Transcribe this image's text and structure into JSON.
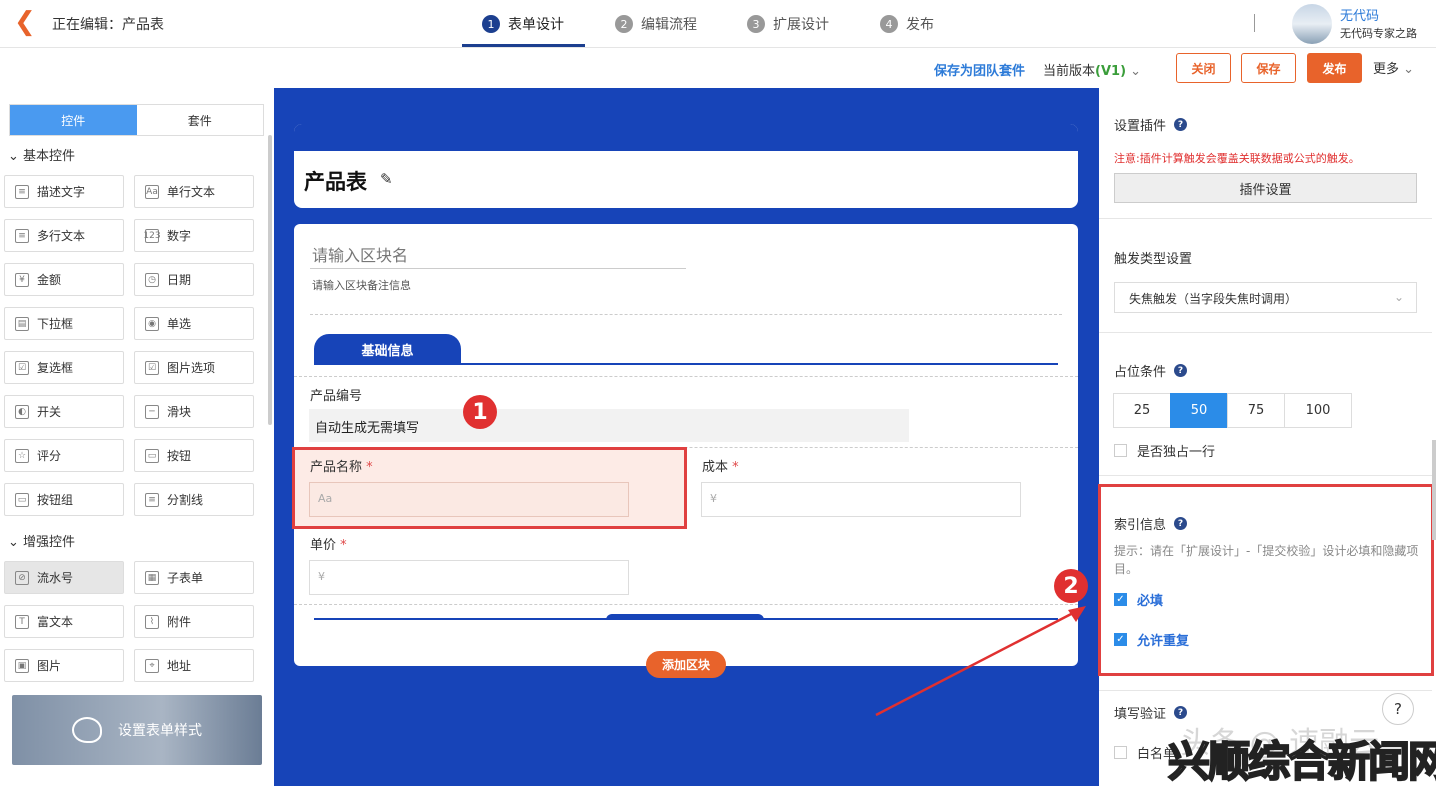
{
  "header": {
    "back_icon": "←",
    "editing": "正在编辑：产品表",
    "steps": [
      {
        "num": "1",
        "label": "表单设计"
      },
      {
        "num": "2",
        "label": "编辑流程"
      },
      {
        "num": "3",
        "label": "扩展设计"
      },
      {
        "num": "4",
        "label": "发布"
      }
    ],
    "user_name": "无代码",
    "user_sub": "无代码专家之路"
  },
  "toolbar": {
    "save_template": "保存为团队套件",
    "current_version_label": "当前版本",
    "version": "(V1)",
    "close": "关闭",
    "save": "保存",
    "publish": "发布",
    "more": "更多"
  },
  "left": {
    "tabs": [
      "控件",
      "套件"
    ],
    "basic_title": "基本控件",
    "basic": [
      {
        "label": "描述文字",
        "icon": "≡"
      },
      {
        "label": "单行文本",
        "icon": "Aa"
      },
      {
        "label": "多行文本",
        "icon": "≡"
      },
      {
        "label": "数字",
        "icon": "123"
      },
      {
        "label": "金额",
        "icon": "¥"
      },
      {
        "label": "日期",
        "icon": "◷"
      },
      {
        "label": "下拉框",
        "icon": "▤"
      },
      {
        "label": "单选",
        "icon": "◉"
      },
      {
        "label": "复选框",
        "icon": "☑"
      },
      {
        "label": "图片选项",
        "icon": "☑"
      },
      {
        "label": "开关",
        "icon": "◐"
      },
      {
        "label": "滑块",
        "icon": "─"
      },
      {
        "label": "评分",
        "icon": "☆"
      },
      {
        "label": "按钮",
        "icon": "▭"
      },
      {
        "label": "按钮组",
        "icon": "▭"
      },
      {
        "label": "分割线",
        "icon": "≡"
      }
    ],
    "enhanced_title": "增强控件",
    "enhanced": [
      {
        "label": "流水号",
        "icon": "⊘"
      },
      {
        "label": "子表单",
        "icon": "▦"
      },
      {
        "label": "富文本",
        "icon": "T"
      },
      {
        "label": "附件",
        "icon": "⌇"
      },
      {
        "label": "图片",
        "icon": "▣"
      },
      {
        "label": "地址",
        "icon": "⌖"
      }
    ],
    "style_card": "设置表单样式"
  },
  "form": {
    "title": "产品表",
    "block_name_placeholder": "请输入区块名",
    "block_remark_placeholder": "请输入区块备注信息",
    "section_tab": "基础信息",
    "fields": {
      "product_no_label": "产品编号",
      "product_no_value": "自动生成无需填写",
      "product_name_label": "产品名称",
      "product_name_placeholder": "Aa",
      "cost_label": "成本",
      "cost_placeholder": "¥",
      "price_label": "单价",
      "price_placeholder": "¥",
      "required_mark": "*"
    },
    "add_block": "添加区块",
    "badge1": "1",
    "badge2": "2"
  },
  "right": {
    "plugin_title": "设置插件",
    "plugin_note": "注意:插件计算触发会覆盖关联数据或公式的触发。",
    "plugin_button": "插件设置",
    "trigger_title": "触发类型设置",
    "trigger_value": "失焦触发（当字段失焦时调用）",
    "width_title": "占位条件",
    "width_options": [
      "25",
      "50",
      "75",
      "100"
    ],
    "own_row": "是否独占一行",
    "index_title": "索引信息",
    "index_hint": "提示：请在「扩展设计」-「提交校验」设计必填和隐藏项目。",
    "required": "必填",
    "allow_dup": "允许重复",
    "validate_title": "填写验证",
    "whitelist": "白名单",
    "help": "?"
  },
  "watermark": "兴顺综合新闻网",
  "watermark2": "头条 @ 速融云",
  "colors": {
    "accent": "#e8632b",
    "canvas": "#1744b8",
    "link": "#2d7bd8",
    "highlight": "#e04040"
  }
}
